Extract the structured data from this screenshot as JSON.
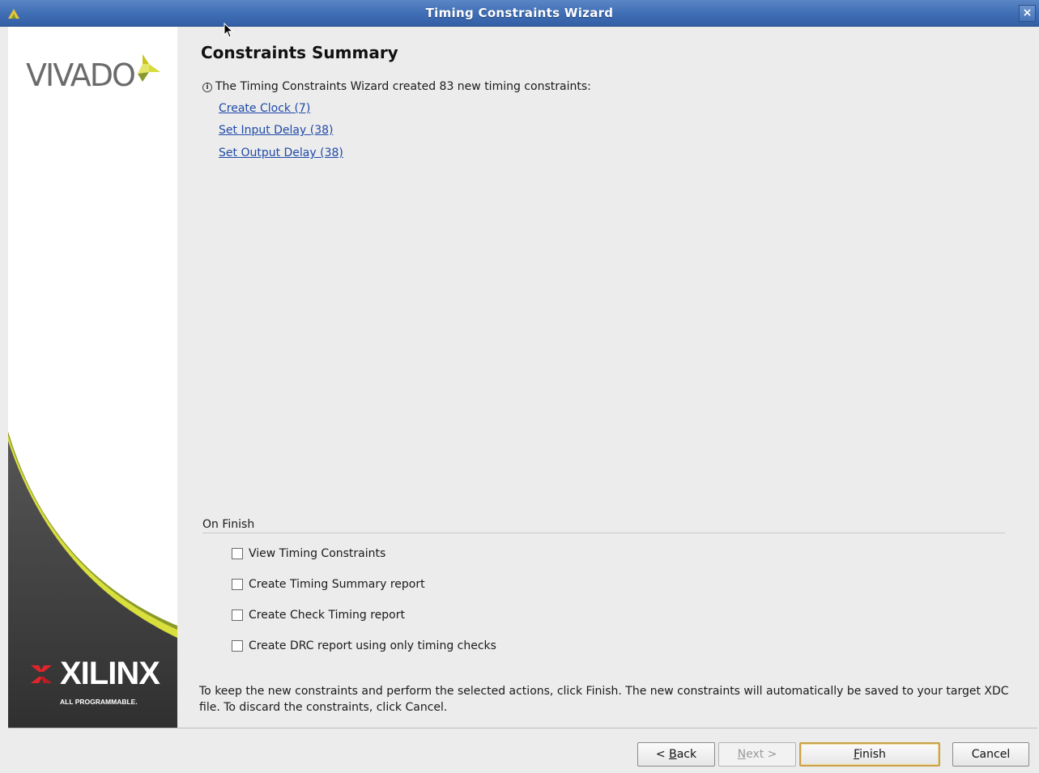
{
  "window": {
    "title": "Timing Constraints Wizard",
    "close_glyph": "×"
  },
  "branding": {
    "top_logo": "VIVADO",
    "bottom_logo": "XILINX",
    "bottom_tagline": "ALL PROGRAMMABLE."
  },
  "page": {
    "title": "Constraints Summary",
    "info_icon": "info-icon",
    "info_text": "The Timing Constraints Wizard created 83 new timing constraints:",
    "links": [
      {
        "label": "Create Clock (7)"
      },
      {
        "label": "Set Input Delay (38)"
      },
      {
        "label": "Set Output Delay (38)"
      }
    ]
  },
  "on_finish": {
    "label": "On Finish",
    "options": [
      {
        "label": "View Timing Constraints",
        "checked": false
      },
      {
        "label": "Create Timing Summary report",
        "checked": false
      },
      {
        "label": "Create Check Timing report",
        "checked": false
      },
      {
        "label": "Create DRC report using only timing checks",
        "checked": false
      }
    ]
  },
  "footer_text": "To keep the new constraints and perform the selected actions, click Finish. The new constraints will automatically be saved to your target XDC file. To discard the constraints, click Cancel.",
  "buttons": {
    "back": {
      "pre": "< ",
      "mnemonic": "B",
      "post": "ack"
    },
    "next": {
      "pre": "",
      "mnemonic": "N",
      "post": "ext >"
    },
    "finish": {
      "pre": "",
      "mnemonic": "F",
      "post": "inish"
    },
    "cancel": "Cancel"
  },
  "colors": {
    "titlebar": "#3f6db4",
    "link": "#1f4aa8",
    "vivado_accent_yellow": "#d7dc3a",
    "vivado_accent_olive": "#8a9a2a",
    "xilinx_red": "#e0252b",
    "brand_dark": "#3c3c3c"
  }
}
